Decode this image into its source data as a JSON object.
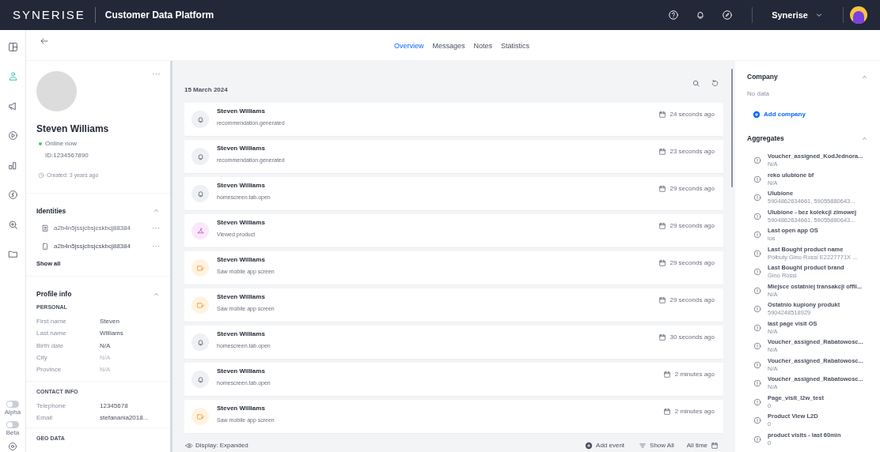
{
  "topbar": {
    "logo": "SYNERISE",
    "product": "Customer Data Platform",
    "workspace": "Synerise"
  },
  "rail": {
    "items": [
      {
        "selected": false
      },
      {
        "selected": true
      },
      {
        "selected": false
      },
      {
        "selected": false
      },
      {
        "selected": false
      },
      {
        "selected": false
      },
      {
        "selected": false
      },
      {
        "selected": false
      }
    ],
    "toggles": [
      {
        "label": "Alpha",
        "on": false
      },
      {
        "label": "Beta",
        "on": false
      }
    ]
  },
  "tabs": [
    {
      "label": "Overview",
      "selected": true
    },
    {
      "label": "Messages",
      "selected": false
    },
    {
      "label": "Notes",
      "selected": false
    },
    {
      "label": "Statistics",
      "selected": false
    }
  ],
  "profile": {
    "more": "···",
    "name": "Steven Williams",
    "status": "Online now",
    "id": "ID:1234567890",
    "created": "Created: 3 years ago",
    "identities": {
      "title": "Identities",
      "items": [
        {
          "kind": "badge",
          "value": "a2b4n5jssjcbsjcskbcj88384",
          "more": "···"
        },
        {
          "kind": "phone",
          "value": "a2b4n5jssjcbsjcskbcj88384",
          "more": "···"
        }
      ],
      "show_all": "Show all"
    },
    "info": {
      "title": "Profile info",
      "groups": [
        {
          "title": "PERSONAL",
          "fields": [
            {
              "label": "First name",
              "value": "Steven",
              "disabled": false
            },
            {
              "label": "Last name",
              "value": "Williams",
              "disabled": false
            },
            {
              "label": "Birth date",
              "value": "N/A",
              "disabled": false
            },
            {
              "label": "City",
              "value": "N/A",
              "disabled": true
            },
            {
              "label": "Province",
              "value": "N/A",
              "disabled": true
            }
          ]
        },
        {
          "title": "CONTACT INFO",
          "fields": [
            {
              "label": "Telephone",
              "value": "12345678",
              "disabled": false
            },
            {
              "label": "Email",
              "value": "stefanania2018...",
              "disabled": false
            }
          ]
        },
        {
          "title": "GEO DATA"
        }
      ]
    }
  },
  "timeline": {
    "date": "15 March 2024",
    "events": [
      {
        "kind": "bell",
        "name": "Steven Williams",
        "action": "recommendation.generated",
        "time": "24 seconds ago"
      },
      {
        "kind": "bell",
        "name": "Steven Williams",
        "action": "recommendation.generated",
        "time": "23 seconds ago"
      },
      {
        "kind": "bell",
        "name": "Steven Williams",
        "action": "homescreen.tab.open",
        "time": "29 seconds ago"
      },
      {
        "kind": "hanger",
        "name": "Steven Williams",
        "action": "Viewed product",
        "time": "29 seconds ago"
      },
      {
        "kind": "screen",
        "name": "Steven Williams",
        "action": "Saw mobile app screen",
        "time": "29 seconds ago"
      },
      {
        "kind": "screen",
        "name": "Steven Williams",
        "action": "Saw mobile app screen",
        "time": "29 seconds ago"
      },
      {
        "kind": "bell",
        "name": "Steven Williams",
        "action": "homescreen.tab.open",
        "time": "30 seconds ago"
      },
      {
        "kind": "bell",
        "name": "Steven Williams",
        "action": "homescreen.tab.open",
        "time": "2 minutes ago"
      },
      {
        "kind": "screen",
        "name": "Steven Williams",
        "action": "Saw mobile app screen",
        "time": "2 minutes ago"
      }
    ],
    "footer": {
      "display": "Display: Expanded",
      "add_event": "Add event",
      "show_all": "Show All",
      "range": "All time"
    }
  },
  "company": {
    "title": "Company",
    "empty": "No data",
    "add": "Add company"
  },
  "aggregates": {
    "title": "Aggregates",
    "items": [
      {
        "name": "Voucher_assigned_KodJednora...",
        "value": "N/A"
      },
      {
        "name": "reko ulubione bf",
        "value": "N/A"
      },
      {
        "name": "Ulubione",
        "value": "5904862634661, 59055880643..."
      },
      {
        "name": "Ulubione - bez kolekcji zimowej",
        "value": "5904862634661, 59055880643..."
      },
      {
        "name": "Last open app OS",
        "value": "ios"
      },
      {
        "name": "Last Bought product name",
        "value": "Półbuty Gino Rossi E2227771X ..."
      },
      {
        "name": "Last Bought product brand",
        "value": "Gino Rossi"
      },
      {
        "name": "Miejsce ostatniej transakcji offli...",
        "value": "N/A"
      },
      {
        "name": "Ostatnio kupiony produkt",
        "value": "5904248518929"
      },
      {
        "name": "last page visit OS",
        "value": "N/A"
      },
      {
        "name": "Voucher_assigned_Rabatowosc...",
        "value": "N/A"
      },
      {
        "name": "Voucher_assigned_Rabatowosc...",
        "value": "N/A"
      },
      {
        "name": "Voucher_assigned_Rabatowosc...",
        "value": "N/A"
      },
      {
        "name": "Page_visit_l2w_test",
        "value": "0"
      },
      {
        "name": "Product View L2D",
        "value": "0"
      },
      {
        "name": "product visits - last 60min",
        "value": "0"
      }
    ]
  }
}
